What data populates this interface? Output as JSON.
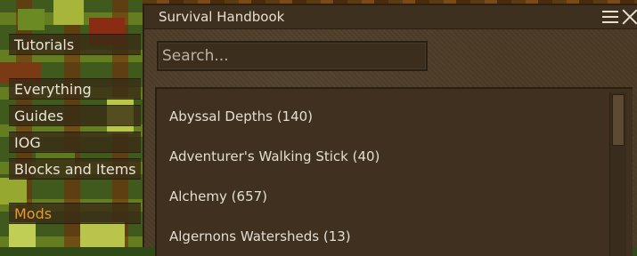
{
  "window": {
    "title": "Survival Handbook"
  },
  "search": {
    "placeholder": "Search..."
  },
  "side_menu": {
    "items": [
      {
        "label": "Tutorials"
      },
      {
        "label": "Everything"
      },
      {
        "label": "Guides"
      },
      {
        "label": "IOG"
      },
      {
        "label": "Blocks and Items"
      },
      {
        "label": "Mods",
        "active": true
      }
    ]
  },
  "list": {
    "items": [
      {
        "label": "Abyssal Depths (140)"
      },
      {
        "label": "Adventurer's Walking Stick (40)"
      },
      {
        "label": "Alchemy (657)"
      },
      {
        "label": "Algernons Watersheds (13)"
      }
    ]
  },
  "colors": {
    "panel": "#4b3a25",
    "active_menu_text": "#e59a35",
    "text": "#e6dfd2"
  },
  "icons": {
    "menu": "hamburger-menu-icon",
    "close": "close-icon"
  }
}
